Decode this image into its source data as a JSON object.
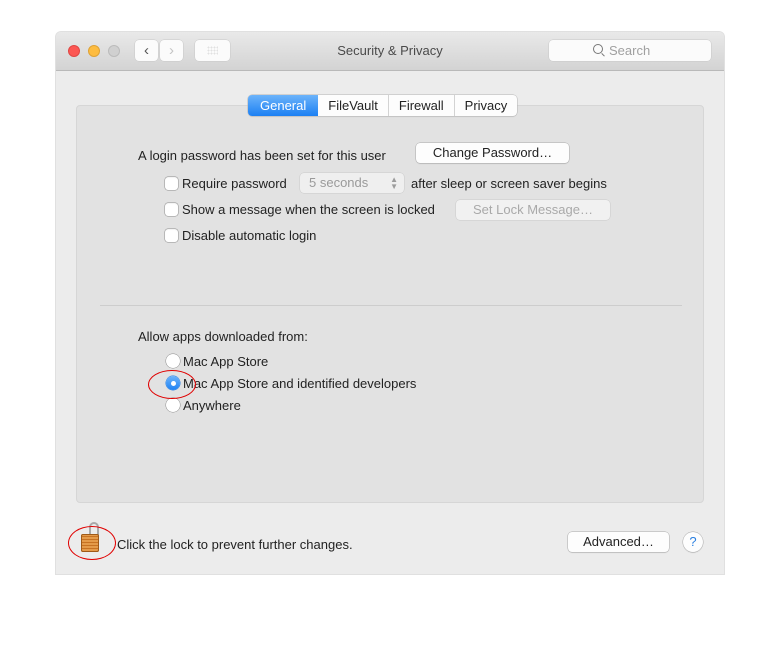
{
  "window": {
    "title": "Security & Privacy",
    "search_placeholder": "Search",
    "nav": {
      "back_icon": "chevron-left",
      "forward_icon": "chevron-right",
      "grid_icon": "show-all-grid"
    }
  },
  "tabs": [
    {
      "label": "General",
      "active": true
    },
    {
      "label": "FileVault",
      "active": false
    },
    {
      "label": "Firewall",
      "active": false
    },
    {
      "label": "Privacy",
      "active": false
    }
  ],
  "general": {
    "login_password_text": "A login password has been set for this user",
    "change_password_label": "Change Password…",
    "require_password": {
      "label": "Require password",
      "checked": false,
      "delay_value": "5 seconds",
      "suffix": "after sleep or screen saver begins"
    },
    "show_message": {
      "label": "Show a message when the screen is locked",
      "checked": false,
      "button_label": "Set Lock Message…"
    },
    "disable_auto_login": {
      "label": "Disable automatic login",
      "checked": false
    },
    "allow_apps": {
      "heading": "Allow apps downloaded from:",
      "options": [
        {
          "label": "Mac App Store",
          "selected": false
        },
        {
          "label": "Mac App Store and identified developers",
          "selected": true
        },
        {
          "label": "Anywhere",
          "selected": false
        }
      ]
    }
  },
  "footer": {
    "lock_text": "Click the lock to prevent further changes.",
    "lock_state": "unlocked",
    "advanced_label": "Advanced…",
    "help_label": "?"
  },
  "colors": {
    "accent": "#1c80f3",
    "annotation": "#e00000"
  }
}
